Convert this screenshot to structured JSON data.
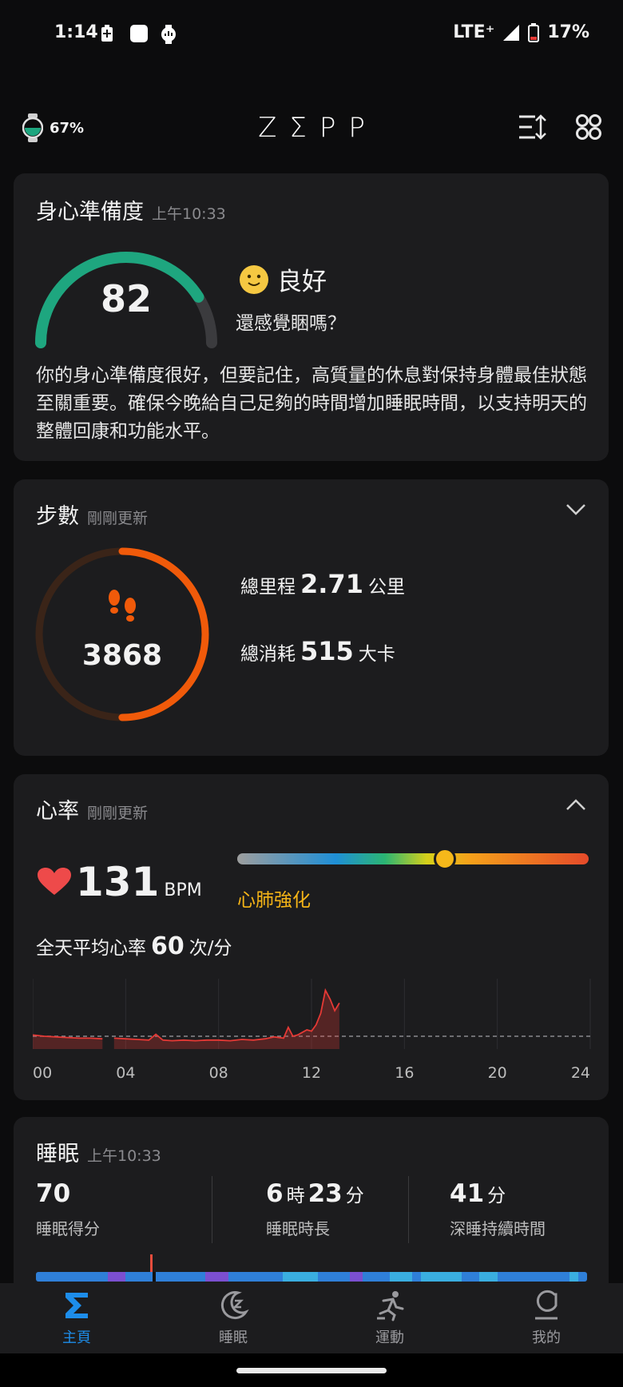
{
  "status": {
    "time": "1:14",
    "network": "LTE⁺",
    "battery": "17%"
  },
  "header": {
    "watch_battery": "67%",
    "logo": "ZΣPP"
  },
  "readiness": {
    "title": "身心準備度",
    "time": "上午10:33",
    "score": "82",
    "score_fraction": 0.82,
    "mood": "良好",
    "question": "還感覺睏嗎？",
    "description": "你的身心準備度很好，但要記住，高質量的休息對保持身體最佳狀態至關重要。確保今晚給自己足夠的時間增加睡眠時間，以支持明天的整體回康和功能水平。",
    "colors": {
      "accent": "#1ea67f",
      "track": "#3b3b3e"
    }
  },
  "steps": {
    "title": "步數",
    "updated": "剛剛更新",
    "count": "3868",
    "progress_fraction": 0.5,
    "distance_label": "總里程",
    "distance_value": "2.71",
    "distance_unit": "公里",
    "calories_label": "總消耗",
    "calories_value": "515",
    "calories_unit": "大卡",
    "colors": {
      "accent": "#f05a0a",
      "track": "#3a2418"
    }
  },
  "heart_rate": {
    "title": "心率",
    "updated": "剛剛更新",
    "value": "131",
    "unit": "BPM",
    "zone": "心肺強化",
    "zone_fraction": 0.59,
    "avg_label": "全天平均心率",
    "avg_value": "60",
    "avg_unit": "次/分",
    "colors": {
      "heart": "#ee4a4a",
      "zone": "#f5b417",
      "line": "#e53935"
    }
  },
  "chart_data": {
    "type": "line",
    "x_tick_labels": [
      "00",
      "04",
      "08",
      "12",
      "16",
      "20",
      "24"
    ],
    "xlim": [
      0,
      24
    ],
    "ylim": [
      40,
      150
    ],
    "average_line": 60,
    "series": [
      {
        "x": [
          0,
          0.5,
          1,
          1.5,
          2,
          2.5,
          3,
          3.1,
          3.2,
          3.3,
          3.5,
          4,
          4.5,
          5,
          5.3,
          5.6,
          6,
          6.5,
          7,
          7.5,
          8,
          8.5,
          9,
          9.5,
          10,
          10.4,
          10.8,
          11,
          11.2,
          11.4,
          11.6,
          11.8,
          12,
          12.2,
          12.4,
          12.6,
          12.8,
          13.0,
          13.2
        ],
        "y": [
          62,
          60,
          59,
          58,
          57,
          57,
          56,
          null,
          null,
          null,
          57,
          56,
          55,
          54,
          63,
          54,
          53,
          54,
          53,
          54,
          54,
          53,
          55,
          54,
          56,
          59,
          57,
          74,
          60,
          62,
          66,
          70,
          68,
          78,
          96,
          132,
          118,
          100,
          112
        ]
      }
    ]
  },
  "sleep": {
    "title": "睡眠",
    "time": "上午10:33",
    "score": "70",
    "score_label": "睡眠得分",
    "duration_h": "6",
    "duration_h_unit": "時",
    "duration_m": "23",
    "duration_m_unit": "分",
    "duration_label": "睡眠時長",
    "deep_value": "41",
    "deep_unit": "分",
    "deep_label": "深睡持續時間",
    "colors": {
      "light": "#2f7fd8",
      "rem": "#7b4fd0",
      "awake": "#3aaee0",
      "marker": "#e84d3d"
    }
  },
  "nav": {
    "items": [
      {
        "label": "主頁",
        "active": true
      },
      {
        "label": "睡眠",
        "active": false
      },
      {
        "label": "運動",
        "active": false
      },
      {
        "label": "我的",
        "active": false
      }
    ]
  }
}
